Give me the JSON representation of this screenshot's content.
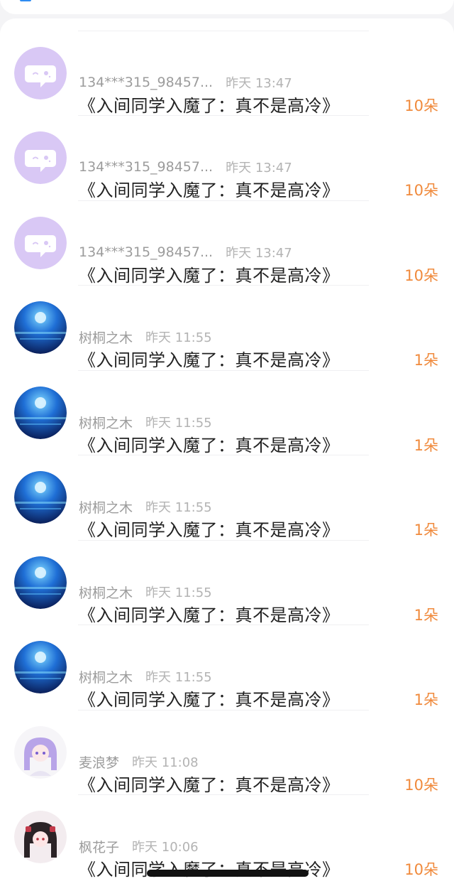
{
  "colors": {
    "background": "#f4f4f6",
    "card": "#ffffff",
    "name_text": "#9c9c9c",
    "time_text": "#b3b3b3",
    "title_text": "#222222",
    "count_accent": "#f08a3c",
    "default_avatar": "#d9c8f5"
  },
  "rows": [
    {
      "avatar": "default-chat-bubble-icon",
      "name": "134***315_98457...",
      "time": "昨天 13:47",
      "title": "《入间同学入魔了：真不是高冷》",
      "count": "10朵"
    },
    {
      "avatar": "default-chat-bubble-icon",
      "name": "134***315_98457...",
      "time": "昨天 13:47",
      "title": "《入间同学入魔了：真不是高冷》",
      "count": "10朵"
    },
    {
      "avatar": "default-chat-bubble-icon",
      "name": "134***315_98457...",
      "time": "昨天 13:47",
      "title": "《入间同学入魔了：真不是高冷》",
      "count": "10朵"
    },
    {
      "avatar": "night-sea-moon-photo",
      "name": "树桐之木",
      "time": "昨天 11:55",
      "title": "《入间同学入魔了：真不是高冷》",
      "count": "1朵"
    },
    {
      "avatar": "night-sea-moon-photo",
      "name": "树桐之木",
      "time": "昨天 11:55",
      "title": "《入间同学入魔了：真不是高冷》",
      "count": "1朵"
    },
    {
      "avatar": "night-sea-moon-photo",
      "name": "树桐之木",
      "time": "昨天 11:55",
      "title": "《入间同学入魔了：真不是高冷》",
      "count": "1朵"
    },
    {
      "avatar": "night-sea-moon-photo",
      "name": "树桐之木",
      "time": "昨天 11:55",
      "title": "《入间同学入魔了：真不是高冷》",
      "count": "1朵"
    },
    {
      "avatar": "night-sea-moon-photo",
      "name": "树桐之木",
      "time": "昨天 11:55",
      "title": "《入间同学入魔了：真不是高冷》",
      "count": "1朵"
    },
    {
      "avatar": "anime-girl-lavender-hair",
      "name": "麦浪梦",
      "time": "昨天 11:08",
      "title": "《入间同学入魔了：真不是高冷》",
      "count": "10朵"
    },
    {
      "avatar": "anime-girl-dark-hair",
      "name": "枫花子",
      "time": "昨天 10:06",
      "title": "《入间同学入魔了：真不是高冷》",
      "count": "10朵"
    }
  ]
}
